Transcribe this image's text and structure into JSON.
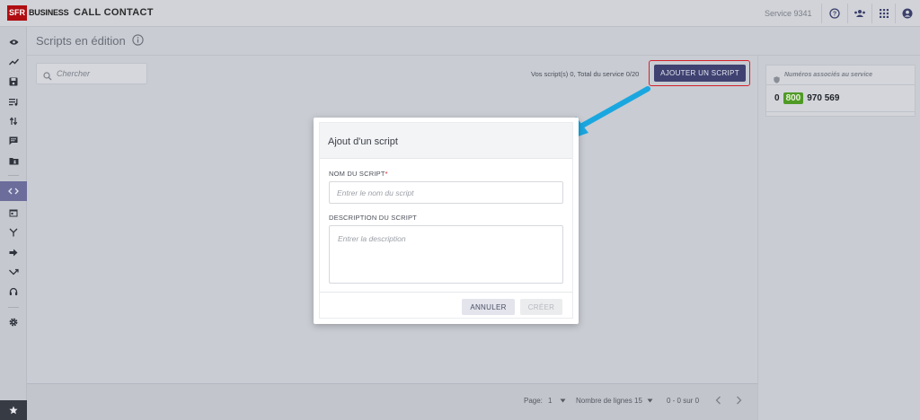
{
  "topbar": {
    "logo_sfr": "SFR",
    "logo_business": "BUSINESS",
    "app_title": "CALL CONTACT",
    "service": "Service 9341"
  },
  "subheader": {
    "title": "Scripts en édition"
  },
  "content": {
    "search_placeholder": "Chercher",
    "scripts_count": "Vos script(s) 0, Total du service 0/20",
    "add_button": "AJOUTER UN SCRIPT"
  },
  "right_panel": {
    "title": "Numéros associés au service",
    "number_prefix": "0",
    "number_badge": "800",
    "number_suffix": "970 569"
  },
  "footer": {
    "page_label": "Page:",
    "page_value": "1",
    "rows_label": "Nombre de lignes",
    "rows_value": "15",
    "range": "0 - 0 sur 0"
  },
  "modal": {
    "title": "Ajout d'un script",
    "name_label": "NOM DU SCRIPT",
    "name_required": "*",
    "name_placeholder": "Entrer le nom du script",
    "desc_label": "DESCRIPTION DU SCRIPT",
    "desc_placeholder": "Entrer la description",
    "cancel": "ANNULER",
    "create": "CRÉER"
  },
  "colors": {
    "primary": "#3f4271",
    "highlight": "#d2222a",
    "badge_green": "#4f9a25",
    "arrow": "#1aa7e0"
  }
}
